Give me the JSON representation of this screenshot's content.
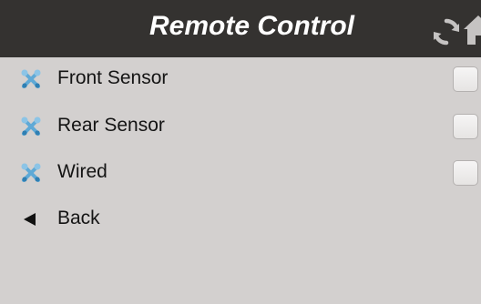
{
  "header": {
    "title": "Remote Control",
    "icons": [
      "refresh-icon",
      "home-icon"
    ]
  },
  "options": [
    {
      "label": "Front Sensor",
      "icon": "tools-icon",
      "checked": false
    },
    {
      "label": "Rear Sensor",
      "icon": "tools-icon",
      "checked": false
    },
    {
      "label": "Wired",
      "icon": "tools-icon",
      "checked": false
    }
  ],
  "back": {
    "label": "Back",
    "icon": "back-arrow-icon"
  },
  "colors": {
    "header_bg": "#343230",
    "body_bg": "#d3d0cf",
    "title_text": "#ffffff",
    "tool_icon": "#5fa9d6"
  }
}
